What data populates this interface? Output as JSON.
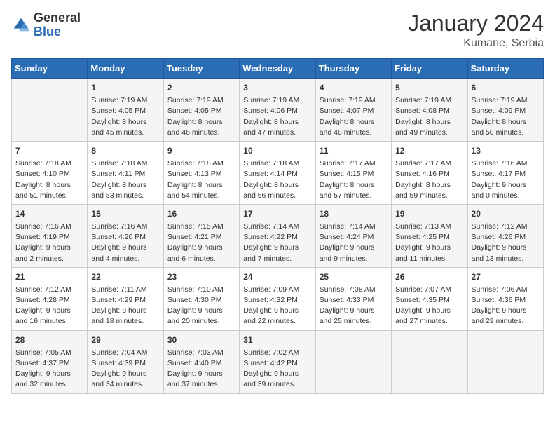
{
  "header": {
    "logo": {
      "text_general": "General",
      "text_blue": "Blue"
    },
    "month": "January 2024",
    "location": "Kumane, Serbia"
  },
  "days_of_week": [
    "Sunday",
    "Monday",
    "Tuesday",
    "Wednesday",
    "Thursday",
    "Friday",
    "Saturday"
  ],
  "weeks": [
    [
      {
        "day": null,
        "info": null
      },
      {
        "day": "1",
        "sunrise": "7:19 AM",
        "sunset": "4:05 PM",
        "daylight": "8 hours and 45 minutes."
      },
      {
        "day": "2",
        "sunrise": "7:19 AM",
        "sunset": "4:05 PM",
        "daylight": "8 hours and 46 minutes."
      },
      {
        "day": "3",
        "sunrise": "7:19 AM",
        "sunset": "4:06 PM",
        "daylight": "8 hours and 47 minutes."
      },
      {
        "day": "4",
        "sunrise": "7:19 AM",
        "sunset": "4:07 PM",
        "daylight": "8 hours and 48 minutes."
      },
      {
        "day": "5",
        "sunrise": "7:19 AM",
        "sunset": "4:08 PM",
        "daylight": "8 hours and 49 minutes."
      },
      {
        "day": "6",
        "sunrise": "7:19 AM",
        "sunset": "4:09 PM",
        "daylight": "8 hours and 50 minutes."
      }
    ],
    [
      {
        "day": "7",
        "sunrise": "7:18 AM",
        "sunset": "4:10 PM",
        "daylight": "8 hours and 51 minutes."
      },
      {
        "day": "8",
        "sunrise": "7:18 AM",
        "sunset": "4:11 PM",
        "daylight": "8 hours and 53 minutes."
      },
      {
        "day": "9",
        "sunrise": "7:18 AM",
        "sunset": "4:13 PM",
        "daylight": "8 hours and 54 minutes."
      },
      {
        "day": "10",
        "sunrise": "7:18 AM",
        "sunset": "4:14 PM",
        "daylight": "8 hours and 56 minutes."
      },
      {
        "day": "11",
        "sunrise": "7:17 AM",
        "sunset": "4:15 PM",
        "daylight": "8 hours and 57 minutes."
      },
      {
        "day": "12",
        "sunrise": "7:17 AM",
        "sunset": "4:16 PM",
        "daylight": "8 hours and 59 minutes."
      },
      {
        "day": "13",
        "sunrise": "7:16 AM",
        "sunset": "4:17 PM",
        "daylight": "9 hours and 0 minutes."
      }
    ],
    [
      {
        "day": "14",
        "sunrise": "7:16 AM",
        "sunset": "4:19 PM",
        "daylight": "9 hours and 2 minutes."
      },
      {
        "day": "15",
        "sunrise": "7:16 AM",
        "sunset": "4:20 PM",
        "daylight": "9 hours and 4 minutes."
      },
      {
        "day": "16",
        "sunrise": "7:15 AM",
        "sunset": "4:21 PM",
        "daylight": "9 hours and 6 minutes."
      },
      {
        "day": "17",
        "sunrise": "7:14 AM",
        "sunset": "4:22 PM",
        "daylight": "9 hours and 7 minutes."
      },
      {
        "day": "18",
        "sunrise": "7:14 AM",
        "sunset": "4:24 PM",
        "daylight": "9 hours and 9 minutes."
      },
      {
        "day": "19",
        "sunrise": "7:13 AM",
        "sunset": "4:25 PM",
        "daylight": "9 hours and 11 minutes."
      },
      {
        "day": "20",
        "sunrise": "7:12 AM",
        "sunset": "4:26 PM",
        "daylight": "9 hours and 13 minutes."
      }
    ],
    [
      {
        "day": "21",
        "sunrise": "7:12 AM",
        "sunset": "4:28 PM",
        "daylight": "9 hours and 16 minutes."
      },
      {
        "day": "22",
        "sunrise": "7:11 AM",
        "sunset": "4:29 PM",
        "daylight": "9 hours and 18 minutes."
      },
      {
        "day": "23",
        "sunrise": "7:10 AM",
        "sunset": "4:30 PM",
        "daylight": "9 hours and 20 minutes."
      },
      {
        "day": "24",
        "sunrise": "7:09 AM",
        "sunset": "4:32 PM",
        "daylight": "9 hours and 22 minutes."
      },
      {
        "day": "25",
        "sunrise": "7:08 AM",
        "sunset": "4:33 PM",
        "daylight": "9 hours and 25 minutes."
      },
      {
        "day": "26",
        "sunrise": "7:07 AM",
        "sunset": "4:35 PM",
        "daylight": "9 hours and 27 minutes."
      },
      {
        "day": "27",
        "sunrise": "7:06 AM",
        "sunset": "4:36 PM",
        "daylight": "9 hours and 29 minutes."
      }
    ],
    [
      {
        "day": "28",
        "sunrise": "7:05 AM",
        "sunset": "4:37 PM",
        "daylight": "9 hours and 32 minutes."
      },
      {
        "day": "29",
        "sunrise": "7:04 AM",
        "sunset": "4:39 PM",
        "daylight": "9 hours and 34 minutes."
      },
      {
        "day": "30",
        "sunrise": "7:03 AM",
        "sunset": "4:40 PM",
        "daylight": "9 hours and 37 minutes."
      },
      {
        "day": "31",
        "sunrise": "7:02 AM",
        "sunset": "4:42 PM",
        "daylight": "9 hours and 39 minutes."
      },
      {
        "day": null,
        "info": null
      },
      {
        "day": null,
        "info": null
      },
      {
        "day": null,
        "info": null
      }
    ]
  ],
  "labels": {
    "sunrise": "Sunrise:",
    "sunset": "Sunset:",
    "daylight": "Daylight:"
  }
}
